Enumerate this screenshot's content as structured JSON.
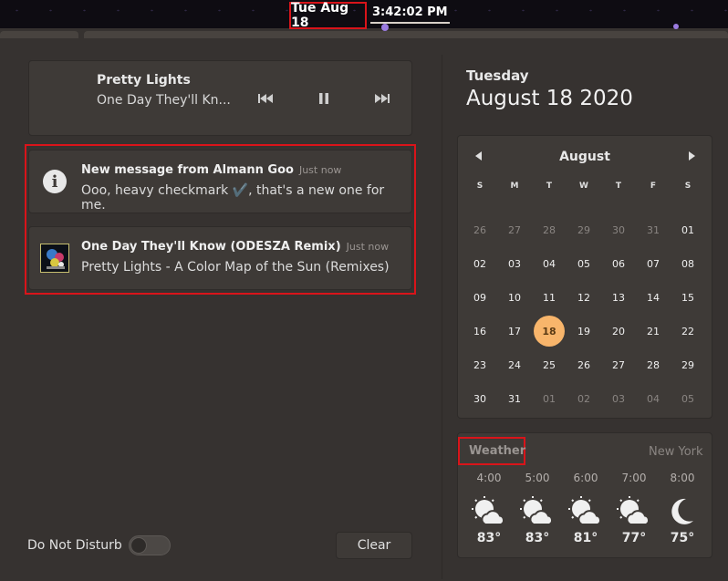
{
  "topbar": {
    "date": "Tue Aug 18",
    "time": "3:42:02 PM"
  },
  "media": {
    "title": "Pretty Lights",
    "artist": "One Day They'll Kn..."
  },
  "notifications": [
    {
      "title": "New message from Almann Goo",
      "time": "Just now",
      "body": "Ooo, heavy checkmark ✔️, that's a new one for me.",
      "icon": "info-icon"
    },
    {
      "title": "One Day They'll Know (ODESZA Remix)",
      "time": "Just now",
      "body": "Pretty Lights - A Color Map of the Sun (Remixes)",
      "icon": "album-art"
    }
  ],
  "footer": {
    "dnd_label": "Do Not Disturb",
    "dnd_on": false,
    "clear_label": "Clear"
  },
  "date_header": {
    "weekday": "Tuesday",
    "full_date": "August 18 2020"
  },
  "calendar": {
    "month": "August",
    "weekdays": [
      "S",
      "M",
      "T",
      "W",
      "T",
      "F",
      "S"
    ],
    "weeks": [
      [
        "26",
        "27",
        "28",
        "29",
        "30",
        "31",
        "01"
      ],
      [
        "02",
        "03",
        "04",
        "05",
        "06",
        "07",
        "08"
      ],
      [
        "09",
        "10",
        "11",
        "12",
        "13",
        "14",
        "15"
      ],
      [
        "16",
        "17",
        "18",
        "19",
        "20",
        "21",
        "22"
      ],
      [
        "23",
        "24",
        "25",
        "26",
        "27",
        "28",
        "29"
      ],
      [
        "30",
        "31",
        "01",
        "02",
        "03",
        "04",
        "05"
      ]
    ],
    "today": "18"
  },
  "weather": {
    "title": "Weather",
    "location": "New York",
    "forecast": [
      {
        "hour": "4:00",
        "temp": "83°",
        "icon": "partly-cloudy-day-icon"
      },
      {
        "hour": "5:00",
        "temp": "83°",
        "icon": "partly-cloudy-day-icon"
      },
      {
        "hour": "6:00",
        "temp": "81°",
        "icon": "partly-cloudy-day-icon"
      },
      {
        "hour": "7:00",
        "temp": "77°",
        "icon": "partly-cloudy-day-icon"
      },
      {
        "hour": "8:00",
        "temp": "75°",
        "icon": "moon-icon"
      }
    ]
  },
  "colors": {
    "accent_today": "#f8b56b",
    "highlight_box": "#d9141a",
    "panel_bg": "#363230",
    "card_bg": "#3e3a37"
  }
}
